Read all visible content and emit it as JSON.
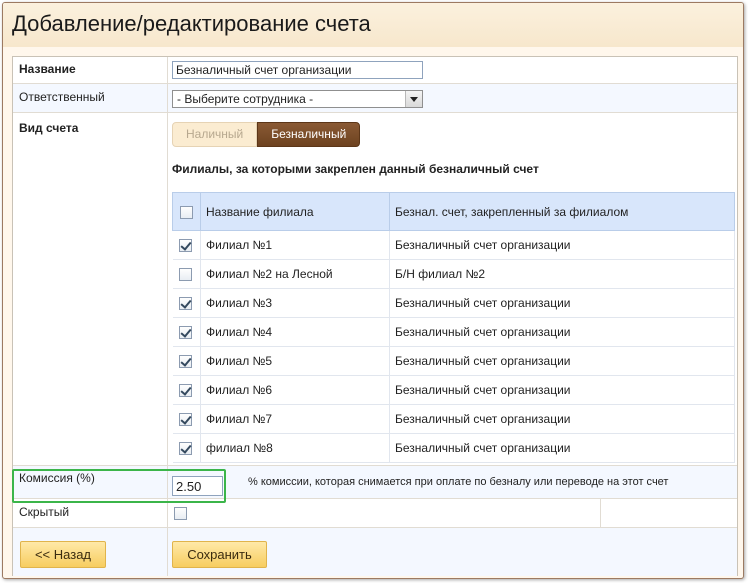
{
  "page": {
    "title": "Добавление/редактирование счета"
  },
  "form": {
    "name": {
      "label": "Название",
      "value": "Безналичный счет организации"
    },
    "responsible": {
      "label": "Ответственный",
      "selected": "- Выберите сотрудника -"
    },
    "account_type": {
      "label": "Вид счета",
      "options": [
        "Наличный",
        "Безналичный"
      ],
      "selected": "Безналичный"
    },
    "branches": {
      "heading": "Филиалы, за которыми закреплен данный безналичный счет",
      "columns": [
        "Название филиала",
        "Безнал. счет, закрепленный за филиалом"
      ],
      "rows": [
        {
          "checked": true,
          "name": "Филиал №1",
          "account": "Безналичный счет организации"
        },
        {
          "checked": false,
          "name": "Филиал №2 на Лесной",
          "account": "Б/Н филиал №2"
        },
        {
          "checked": true,
          "name": "Филиал №3",
          "account": "Безналичный счет организации"
        },
        {
          "checked": true,
          "name": "Филиал №4",
          "account": "Безналичный счет организации"
        },
        {
          "checked": true,
          "name": "Филиал №5",
          "account": "Безналичный счет организации"
        },
        {
          "checked": true,
          "name": "Филиал №6",
          "account": "Безналичный счет организации"
        },
        {
          "checked": true,
          "name": "Филиал №7",
          "account": "Безналичный счет организации"
        },
        {
          "checked": true,
          "name": "филиал №8",
          "account": "Безналичный счет организации"
        }
      ]
    },
    "commission": {
      "label": "Комиссия (%)",
      "value": "2.50",
      "hint": "% комиссии, которая снимается при оплате по безналу или переводе на этот счет"
    },
    "hidden": {
      "label": "Скрытый",
      "checked": false
    }
  },
  "buttons": {
    "back": "<< Назад",
    "save": "Сохранить"
  },
  "colors": {
    "highlight": "#3bb54a",
    "toggle_active": "#6d4220",
    "button": "#f7cd60"
  }
}
